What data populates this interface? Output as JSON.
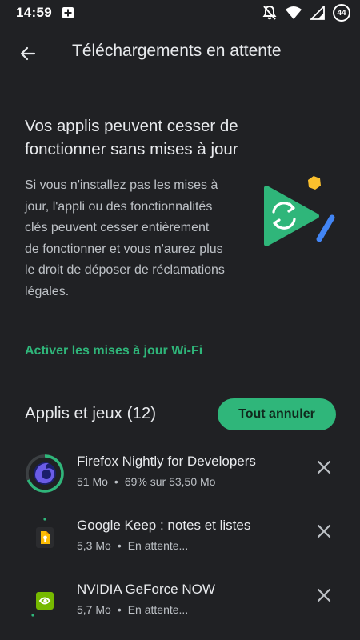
{
  "status_bar": {
    "time": "14:59",
    "battery_level": "44",
    "icons": [
      "add-box-icon",
      "notifications-off-icon",
      "wifi-icon",
      "signal-icon",
      "battery-icon"
    ]
  },
  "header": {
    "title": "Téléchargements en attente",
    "back_icon": "arrow-back-icon"
  },
  "notice": {
    "title": "Vos applis peuvent cesser de fonctionner sans mises à jour",
    "body": "Si vous n'installez pas les mises à jour, l'appli ou des fonctionnalités clés peuvent cesser entièrement de fonctionner et vous n'aurez plus le droit de déposer de réclamations légales.",
    "link": "Activer les mises à jour Wi-Fi"
  },
  "section": {
    "title": "Applis et jeux (12)",
    "cancel_all": "Tout annuler"
  },
  "apps": [
    {
      "name": "Firefox Nightly for Developers",
      "size": "51 Mo",
      "separator": "•",
      "status": "69% sur 53,50 Mo",
      "progress": 0.69,
      "icon": "firefox-nightly-icon"
    },
    {
      "name": "Google Keep : notes et listes",
      "size": "5,3 Mo",
      "separator": "•",
      "status": "En attente...",
      "icon": "google-keep-icon"
    },
    {
      "name": "NVIDIA GeForce NOW",
      "size": "5,7 Mo",
      "separator": "•",
      "status": "En attente...",
      "icon": "nvidia-icon"
    }
  ],
  "colors": {
    "background": "#202124",
    "accent": "#2fb67a",
    "text_primary": "#e8eaed",
    "text_secondary": "#bdc1c6"
  }
}
